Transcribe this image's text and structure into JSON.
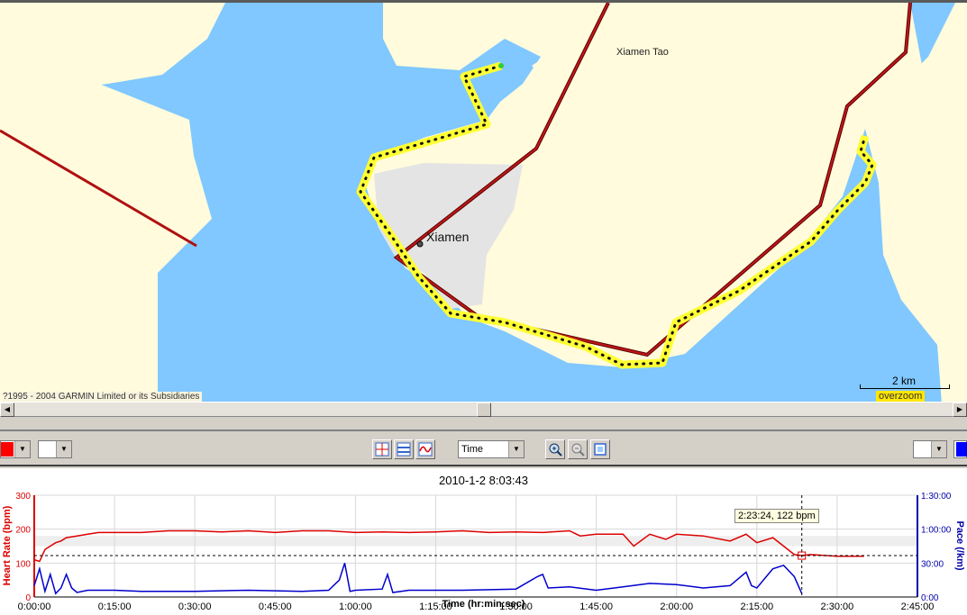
{
  "map": {
    "place_north": "Xiamen Tao",
    "city": "Xiamen",
    "copyright": "?1995 - 2004 GARMIN Limited or its Subsidiaries",
    "scale_label": "2 km",
    "zoom_badge": "overzoom",
    "colors": {
      "water": "#80c8ff",
      "land": "#fffbdc",
      "road": "#b01010",
      "track": "#ffff33",
      "urban": "#e4e4e4"
    }
  },
  "toolbar": {
    "left_color": "#ff0000",
    "right_color": "#0000ff",
    "x_axis_mode": "Time"
  },
  "chart": {
    "title": "2010-1-2 8:03:43",
    "left_axis_label": "Heart Rate (bpm)",
    "right_axis_label": "Pace (/km)",
    "x_axis_label": "Time (hr:min:sec)",
    "cursor_tooltip": "2:23:24, 122 bpm",
    "left_ticks": [
      "300",
      "200",
      "100",
      "0"
    ],
    "right_ticks": [
      "1:30:00",
      "1:00:00",
      "30:00",
      "0:00"
    ],
    "x_ticks": [
      "0:00:00",
      "0:15:00",
      "0:30:00",
      "0:45:00",
      "1:00:00",
      "1:15:00",
      "1:30:00",
      "1:45:00",
      "2:00:00",
      "2:15:00",
      "2:30:00",
      "2:45:00"
    ]
  },
  "chart_data": {
    "type": "line",
    "title": "2010-1-2 8:03:43",
    "xlabel": "Time (hr:min:sec)",
    "ylabel": "Heart Rate (bpm)",
    "ylabel_right": "Pace (/km)",
    "x_unit": "minutes",
    "xlim": [
      0,
      165
    ],
    "ylim": [
      0,
      300
    ],
    "ylim_right_minutes": [
      0,
      90
    ],
    "cursor": {
      "x_min": 143.4,
      "y": 122
    },
    "series": [
      {
        "name": "Heart Rate (bpm)",
        "axis": "left",
        "color": "#dd0000",
        "x": [
          0,
          1,
          2,
          3,
          4,
          5,
          6,
          8,
          10,
          12,
          15,
          20,
          25,
          30,
          35,
          40,
          45,
          50,
          55,
          60,
          65,
          70,
          75,
          80,
          85,
          90,
          95,
          100,
          102,
          105,
          110,
          112,
          115,
          118,
          120,
          125,
          130,
          133,
          135,
          138,
          140,
          142,
          143.4,
          145,
          150,
          155
        ],
        "y": [
          110,
          105,
          140,
          150,
          160,
          165,
          175,
          180,
          185,
          190,
          190,
          190,
          195,
          195,
          192,
          195,
          190,
          195,
          195,
          190,
          192,
          190,
          192,
          195,
          190,
          192,
          190,
          195,
          180,
          185,
          185,
          150,
          185,
          170,
          185,
          180,
          165,
          185,
          160,
          175,
          150,
          125,
          122,
          125,
          120,
          120
        ]
      },
      {
        "name": "Pace (/km)",
        "axis": "right",
        "color": "#0000cc",
        "x": [
          0,
          1,
          2,
          3,
          4,
          5,
          6,
          7,
          8,
          10,
          15,
          20,
          30,
          40,
          50,
          55,
          57,
          58,
          59,
          60,
          65,
          66,
          67,
          70,
          80,
          90,
          94,
          95,
          96,
          100,
          105,
          110,
          115,
          120,
          125,
          130,
          133,
          134,
          135,
          138,
          140,
          142,
          143.4
        ],
        "y": [
          10,
          25,
          5,
          20,
          3,
          8,
          20,
          8,
          4,
          6,
          6,
          5,
          5,
          6,
          5,
          6,
          15,
          30,
          5,
          6,
          7,
          20,
          4,
          6,
          6,
          7,
          18,
          20,
          8,
          9,
          6,
          9,
          12,
          11,
          8,
          10,
          22,
          10,
          8,
          25,
          28,
          18,
          3
        ]
      }
    ]
  }
}
